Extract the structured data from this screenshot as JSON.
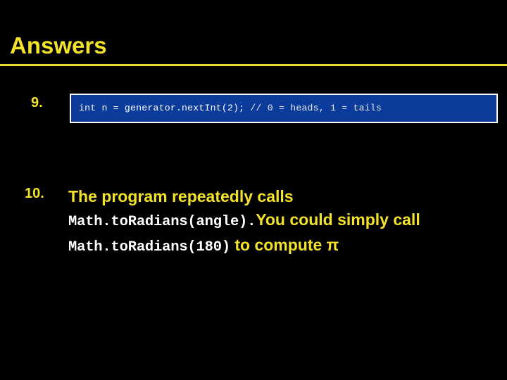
{
  "slide": {
    "title": "Answers",
    "accent_color": "#F2E229",
    "background_color": "#000000",
    "rule_color": "#E8D939"
  },
  "items": [
    {
      "number": "9.",
      "type": "code-callout",
      "code": {
        "statement": "int n = generator.nextInt(2); ",
        "comment": "// 0 = heads, 1 = tails",
        "box_background": "#0B3B9B",
        "box_border": "#FFFFFF",
        "text_color": "#FFFFFF"
      }
    },
    {
      "number": "10.",
      "type": "prose",
      "segments": [
        {
          "style": "prose",
          "text": "The program repeatedly calls "
        },
        {
          "style": "mono",
          "text": "Math.toRadians(angle)."
        },
        {
          "style": "prose",
          "text": "You could simply call "
        },
        {
          "style": "mono",
          "text": "Math.toRadians(180)"
        },
        {
          "style": "prose",
          "text": " to compute π"
        }
      ]
    }
  ]
}
